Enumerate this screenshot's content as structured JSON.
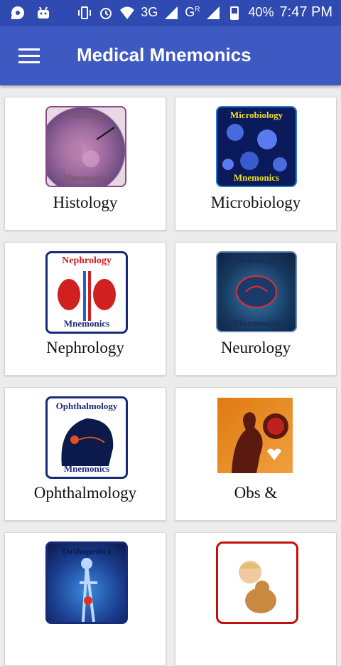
{
  "status_bar": {
    "battery": "40%",
    "network_1": "3G",
    "network_2": "G",
    "network_2_sup": "R",
    "time": "7:47 PM"
  },
  "app_bar": {
    "title": "Medical Mnemonics",
    "menu_icon": "hamburger-menu-icon"
  },
  "cards": [
    {
      "label": "Histology",
      "thumb_title": "Histology",
      "thumb_footer": "Mnemonics",
      "icon": "histology-icon"
    },
    {
      "label": "Microbiology",
      "thumb_title": "Microbiology",
      "thumb_footer": "Mnemonics",
      "icon": "microbiology-icon"
    },
    {
      "label": "Nephrology",
      "thumb_title": "Nephrology",
      "thumb_footer": "Mnemonics",
      "icon": "nephrology-icon"
    },
    {
      "label": "Neurology",
      "thumb_title": "Neurology",
      "thumb_footer": "Mnemonics",
      "icon": "neurology-icon"
    },
    {
      "label": "Ophthalmology",
      "thumb_title": "Ophthalmology",
      "thumb_footer": "Mnemonics",
      "icon": "ophthalmology-icon"
    },
    {
      "label": "Obs &",
      "icon": "obstetrics-icon"
    },
    {
      "label": "",
      "thumb_title": "Orthopedics",
      "icon": "orthopedics-icon"
    },
    {
      "label": "",
      "icon": "pediatrics-icon"
    }
  ],
  "colors": {
    "app_bar": "#3f59c3",
    "status_bar": "#2f4ab0",
    "background": "#ececec"
  }
}
